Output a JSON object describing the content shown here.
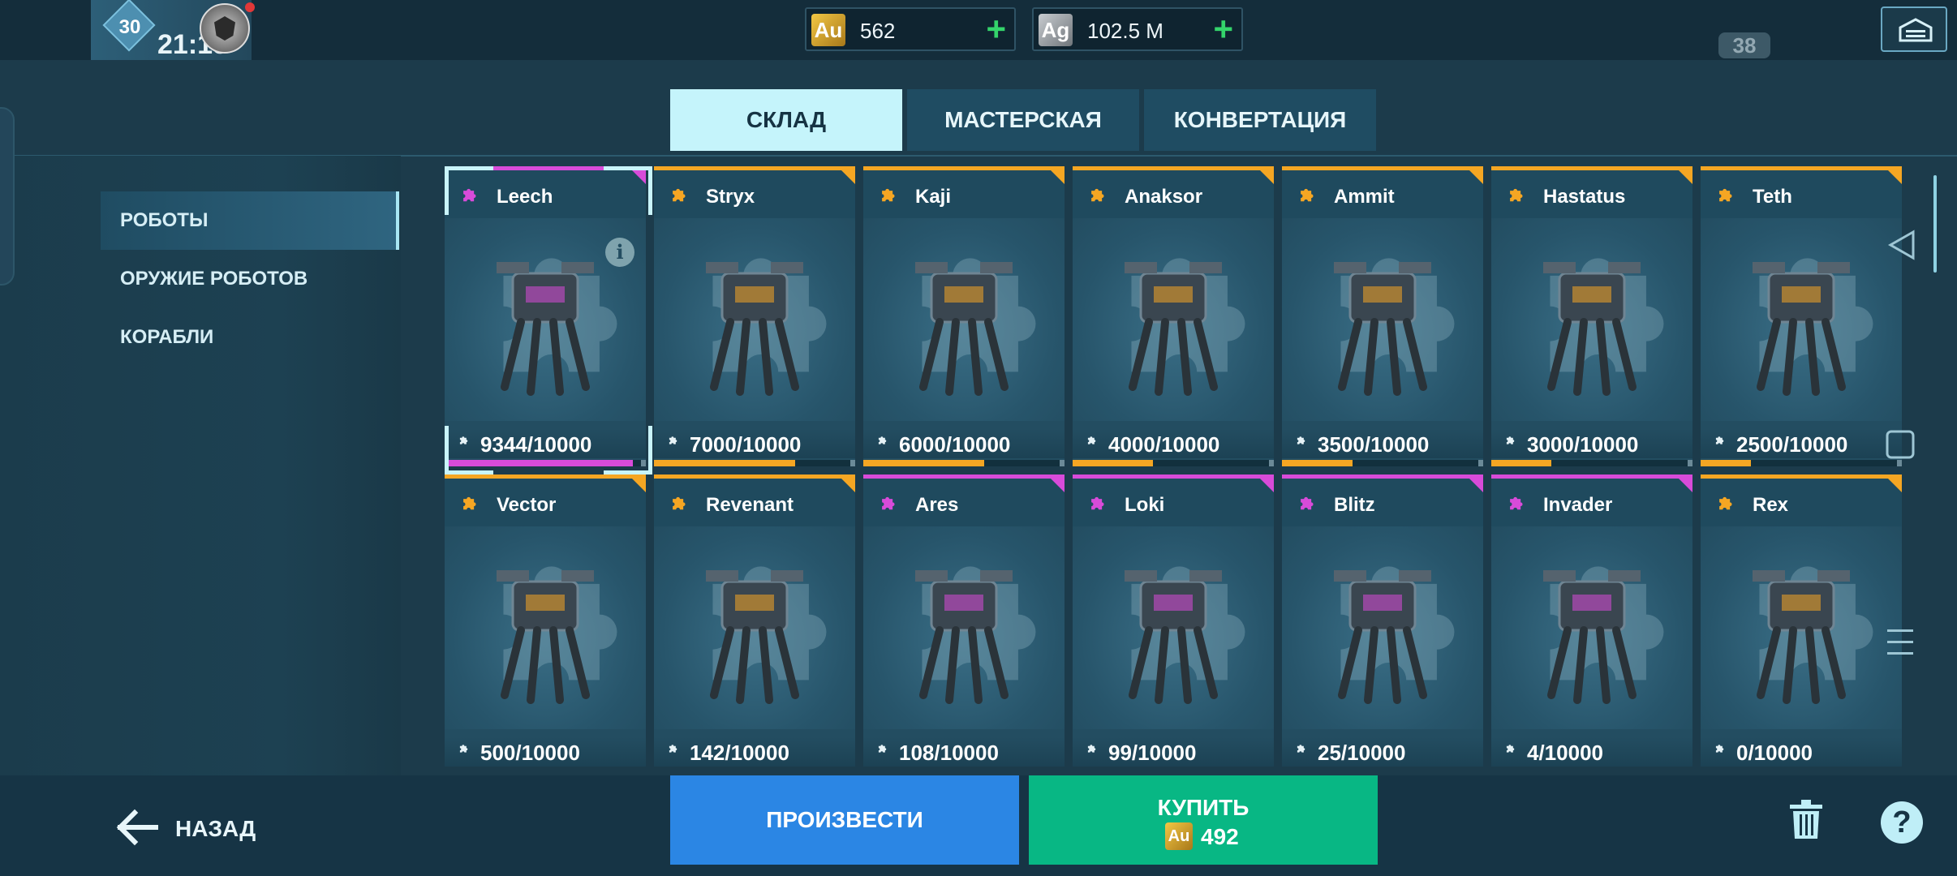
{
  "player": {
    "level": "30",
    "league_time": "21:15"
  },
  "currencies": [
    {
      "code": "Au",
      "amount": "562"
    },
    {
      "code": "Ag",
      "amount": "102.5 M"
    }
  ],
  "timer_badge": "38",
  "tabs": [
    {
      "label": "СКЛАД",
      "active": true
    },
    {
      "label": "МАСТЕРСКАЯ",
      "active": false
    },
    {
      "label": "КОНВЕРТАЦИЯ",
      "active": false
    }
  ],
  "sidebar": {
    "items": [
      {
        "label": "РОБОТЫ",
        "active": true
      },
      {
        "label": "ОРУЖИЕ РОБОТОВ",
        "active": false
      },
      {
        "label": "КОРАБЛИ",
        "active": false
      }
    ]
  },
  "colors": {
    "orange_rarity": "#f5a623",
    "purple_rarity": "#d84bd9",
    "produce": "#2b86e4",
    "buy": "#08b784"
  },
  "robots": [
    {
      "name": "Leech",
      "count": "9344/10000",
      "progress": 0.9344,
      "rarity": "purple"
    },
    {
      "name": "Stryx",
      "count": "7000/10000",
      "progress": 0.7,
      "rarity": "orange"
    },
    {
      "name": "Kaji",
      "count": "6000/10000",
      "progress": 0.6,
      "rarity": "orange"
    },
    {
      "name": "Anaksor",
      "count": "4000/10000",
      "progress": 0.4,
      "rarity": "orange"
    },
    {
      "name": "Ammit",
      "count": "3500/10000",
      "progress": 0.35,
      "rarity": "orange"
    },
    {
      "name": "Hastatus",
      "count": "3000/10000",
      "progress": 0.3,
      "rarity": "orange"
    },
    {
      "name": "Teth",
      "count": "2500/10000",
      "progress": 0.25,
      "rarity": "orange"
    },
    {
      "name": "Vector",
      "count": "500/10000",
      "progress": 0.05,
      "rarity": "orange"
    },
    {
      "name": "Revenant",
      "count": "142/10000",
      "progress": 0.0142,
      "rarity": "orange"
    },
    {
      "name": "Ares",
      "count": "108/10000",
      "progress": 0.0108,
      "rarity": "purple"
    },
    {
      "name": "Loki",
      "count": "99/10000",
      "progress": 0.0099,
      "rarity": "purple"
    },
    {
      "name": "Blitz",
      "count": "25/10000",
      "progress": 0.0025,
      "rarity": "purple"
    },
    {
      "name": "Invader",
      "count": "4/10000",
      "progress": 0.0004,
      "rarity": "purple"
    },
    {
      "name": "Rex",
      "count": "0/10000",
      "progress": 0,
      "rarity": "orange"
    }
  ],
  "footer": {
    "back_label": "НАЗАД",
    "produce_label": "ПРОИЗВЕСТИ",
    "buy_label": "КУПИТЬ",
    "buy_currency": "Au",
    "buy_price": "492",
    "help_glyph": "?"
  }
}
